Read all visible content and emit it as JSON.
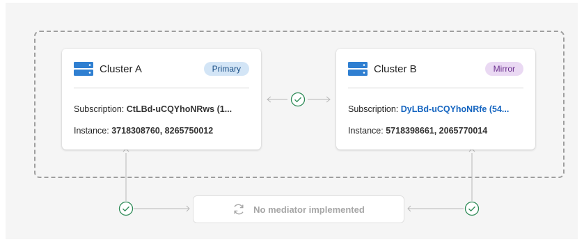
{
  "cluster_a": {
    "title": "Cluster A",
    "badge": "Primary",
    "subscription_label": "Subscription:",
    "subscription_value": "CtLBd-uCQYhoNRws (1...",
    "instance_label": "Instance:",
    "instance_value": "3718308760, 8265750012",
    "icon": "server-icon"
  },
  "cluster_b": {
    "title": "Cluster B",
    "badge": "Mirror",
    "subscription_label": "Subscription:",
    "subscription_value": "DyLBd-uCQYhoNRfe (54...",
    "instance_label": "Instance:",
    "instance_value": "5718398661, 2065770014",
    "icon": "server-icon"
  },
  "mediator": {
    "label": "No mediator implemented",
    "icon": "refresh-icon"
  },
  "colors": {
    "accent": "#2f7fd1",
    "check": "#2e8b57",
    "primary_badge": "#d3e5f6",
    "mirror_badge": "#ead9f3",
    "link": "#1565c0"
  }
}
